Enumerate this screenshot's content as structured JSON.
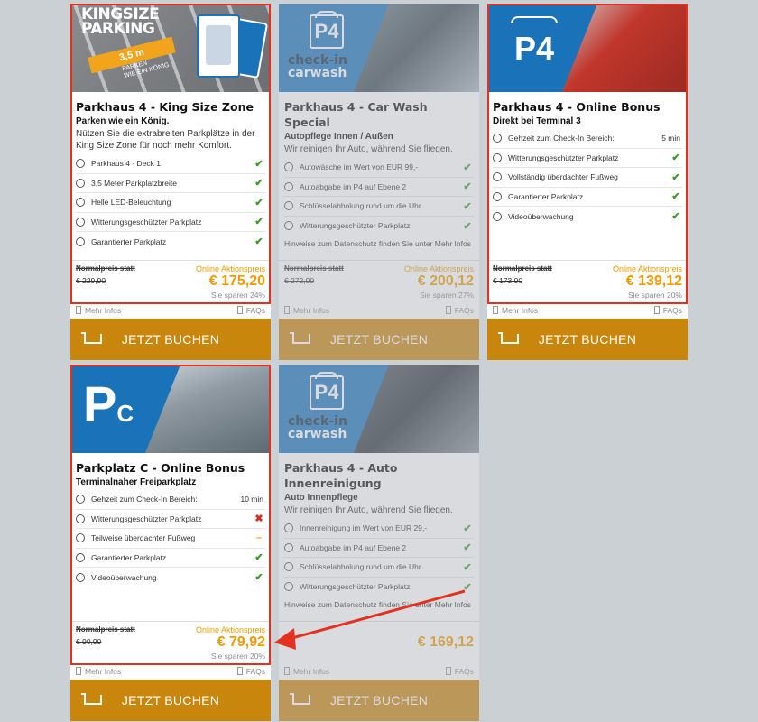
{
  "common": {
    "normal_label": "Normalpreis statt",
    "online_label": "Online Aktionspreis",
    "more_info": "Mehr Infos",
    "faqs": "FAQs",
    "book": "JETZT BUCHEN"
  },
  "colors": {
    "brand_blue": "#1a73b8",
    "accent_orange": "#f29a00",
    "book_button": "#c8860c",
    "highlight_red": "#e3321f",
    "ok_green": "#3a9a2a"
  },
  "cards": [
    {
      "hero": {
        "line1": "KINGSIZE",
        "line2": "PARKING",
        "badge": "3,5 m",
        "tag1": "PARKEN",
        "tag2": "WIE EIN KÖNIG"
      },
      "title": "Parkhaus 4 - King Size Zone",
      "subtitle": "Parken wie ein König.",
      "description": "Nützen Sie die extrabreiten Parkplätze in der King Size Zone für noch mehr Komfort.",
      "features": [
        {
          "icon": "location-icon",
          "text": "Parkhaus 4 - Deck 1",
          "status": "✔"
        },
        {
          "icon": "expand-icon",
          "text": "3,5 Meter Parkplatzbreite",
          "status": "✔"
        },
        {
          "icon": "lightbulb-icon",
          "text": "Helle LED-Beleuchtung",
          "status": "✔"
        },
        {
          "icon": "thermometer-icon",
          "text": "Witterungsgeschützter Parkplatz",
          "status": "✔"
        },
        {
          "icon": "globe-icon",
          "text": "Garantierter Parkplatz",
          "status": "✔"
        }
      ],
      "old_price": "€ 229,90",
      "price": "€ 175,20",
      "savings": "Sie sparen 24%"
    },
    {
      "hero": {
        "sign": "P4",
        "line1": "check-in",
        "line2": "carwash"
      },
      "title": "Parkhaus 4 - Car Wash Special",
      "subtitle": "Autopflege Innen / Außen",
      "description": "Wir reinigen Ihr Auto, während Sie fliegen.",
      "features": [
        {
          "icon": "wash-icon",
          "text": "Autowäsche im Wert von EUR 99,-",
          "status": "✔"
        },
        {
          "icon": "location-icon",
          "text": "Autoabgabe im P4 auf Ebene 2",
          "status": "✔"
        },
        {
          "icon": "key-icon",
          "text": "Schlüsselabholung rund um die Uhr",
          "status": "✔"
        },
        {
          "icon": "thermometer-icon",
          "text": "Witterungsgeschützter Parkplatz",
          "status": "✔"
        }
      ],
      "note": "Hinweise zum Datenschutz finden Sie unter Mehr Infos",
      "old_price": "€ 272,90",
      "price": "€ 200,12",
      "savings": "Sie sparen 27%"
    },
    {
      "hero": {
        "sign": "P4"
      },
      "title": "Parkhaus 4 - Online Bonus",
      "subtitle": "Direkt bei Terminal 3",
      "features": [
        {
          "icon": "clock-icon",
          "text": "Gehzeit zum Check-In Bereich:",
          "value": "5 min"
        },
        {
          "icon": "thermometer-icon",
          "text": "Witterungsgeschützter Parkplatz",
          "status": "✔"
        },
        {
          "icon": "home-icon",
          "text": "Vollständig überdachter Fußweg",
          "status": "✔"
        },
        {
          "icon": "globe-icon",
          "text": "Garantierter Parkplatz",
          "status": "✔"
        },
        {
          "icon": "camera-icon",
          "text": "Videoüberwachung",
          "status": "✔"
        }
      ],
      "old_price": "€ 173,90",
      "price": "€ 139,12",
      "savings": "Sie sparen 20%"
    },
    {
      "hero": {
        "letter": "P",
        "letter_small": "C"
      },
      "title": "Parkplatz C - Online Bonus",
      "subtitle": "Terminalnaher Freiparkplatz",
      "features": [
        {
          "icon": "clock-icon",
          "text": "Gehzeit zum Check-In Bereich:",
          "value": "10 min"
        },
        {
          "icon": "thermometer-icon",
          "text": "Witterungsgeschützter Parkplatz",
          "status": "✖"
        },
        {
          "icon": "home-icon",
          "text": "Teilweise überdachter Fußweg",
          "status": "–"
        },
        {
          "icon": "globe-icon",
          "text": "Garantierter Parkplatz",
          "status": "✔"
        },
        {
          "icon": "camera-icon",
          "text": "Videoüberwachung",
          "status": "✔"
        }
      ],
      "old_price": "€ 99,90",
      "price": "€ 79,92",
      "savings": "Sie sparen 20%"
    },
    {
      "hero": {
        "sign": "P4",
        "line1": "check-in",
        "line2": "carwash"
      },
      "title": "Parkhaus 4 - Auto Innenreinigung",
      "subtitle": "Auto Innenpflege",
      "description": "Wir reinigen Ihr Auto, während Sie fliegen.",
      "features": [
        {
          "icon": "wash-icon",
          "text": "Innenreinigung im Wert von EUR 29,-",
          "status": "✔"
        },
        {
          "icon": "location-icon",
          "text": "Autoabgabe im P4 auf Ebene 2",
          "status": "✔"
        },
        {
          "icon": "key-icon",
          "text": "Schlüsselabholung rund um die Uhr",
          "status": "✔"
        },
        {
          "icon": "thermometer-icon",
          "text": "Witterungsgeschützter Parkplatz",
          "status": "✔"
        }
      ],
      "note": "Hinweise zum Datenschutz finden Sie unter Mehr Infos",
      "price": "€ 169,12"
    }
  ]
}
